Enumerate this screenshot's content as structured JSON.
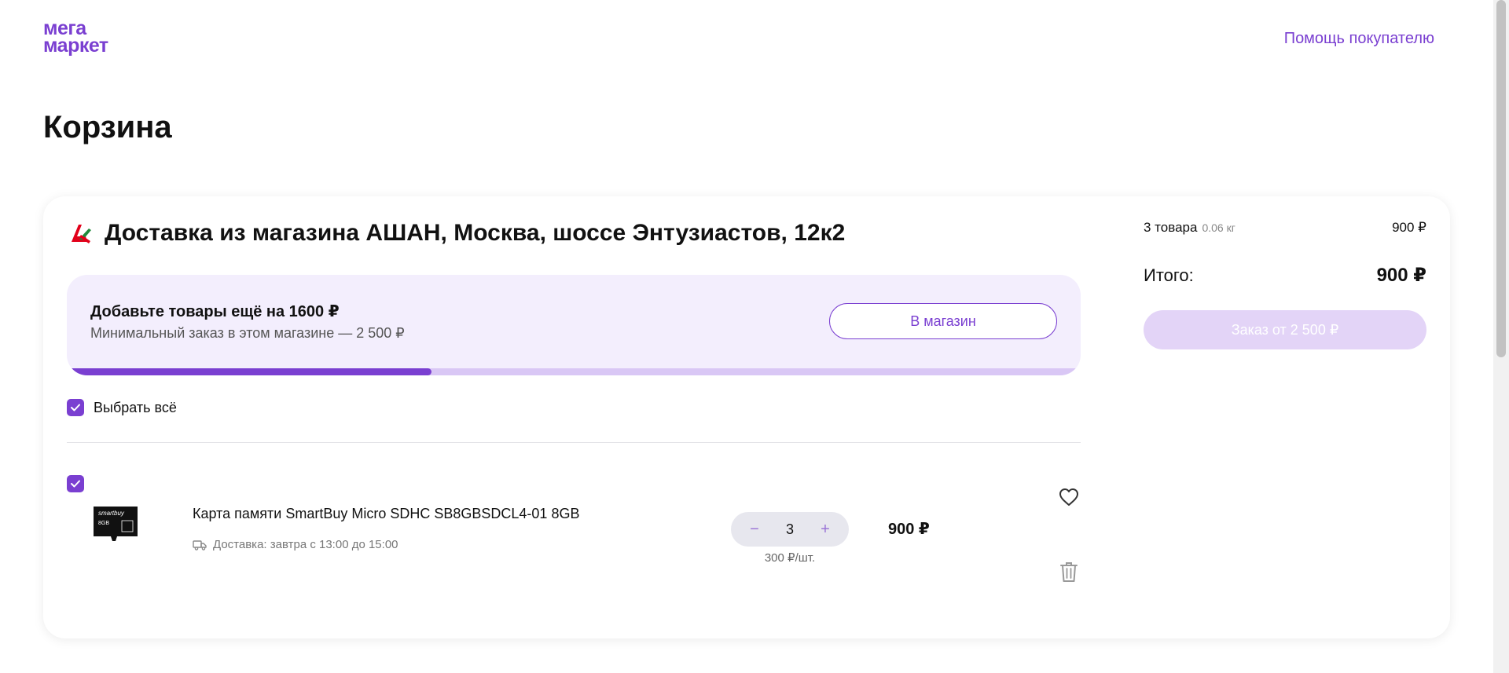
{
  "header": {
    "logo_line1": "мега",
    "logo_line2": "маркет",
    "help_link": "Помощь покупателю"
  },
  "page_title": "Корзина",
  "store": {
    "title": "Доставка из магазина АШАН, Москва, шоссе Энтузиастов, 12к2",
    "logo_icon": "auchan-bird-icon"
  },
  "min_order": {
    "add_text": "Добавьте товары ещё на 1600 ₽",
    "min_text": "Минимальный заказ в этом магазине — 2 500 ₽",
    "to_store_button": "В магазин",
    "progress_fraction": 0.36
  },
  "select_all_label": "Выбрать всё",
  "item": {
    "name": "Карта памяти SmartBuy Micro SDHC SB8GBSDCL4-01 8GB",
    "delivery": "Доставка: завтра с 13:00 до 15:00",
    "quantity": "3",
    "minus": "−",
    "plus": "+",
    "unit_price": "300 ₽/шт.",
    "price": "900 ₽",
    "thumb_brand": "smartbuy",
    "thumb_size": "8GB"
  },
  "summary": {
    "count_label": "3 товара",
    "weight": "0.06 кг",
    "subtotal": "900 ₽",
    "total_label": "Итого:",
    "total_value": "900 ₽",
    "order_button": "Заказ от 2 500 ₽"
  },
  "colors": {
    "accent": "#7a3fd1",
    "accent_light": "#f3eefd",
    "disabled_button": "#e3d4f7",
    "auchan_red": "#e2001a",
    "auchan_green": "#1f8a3b"
  }
}
